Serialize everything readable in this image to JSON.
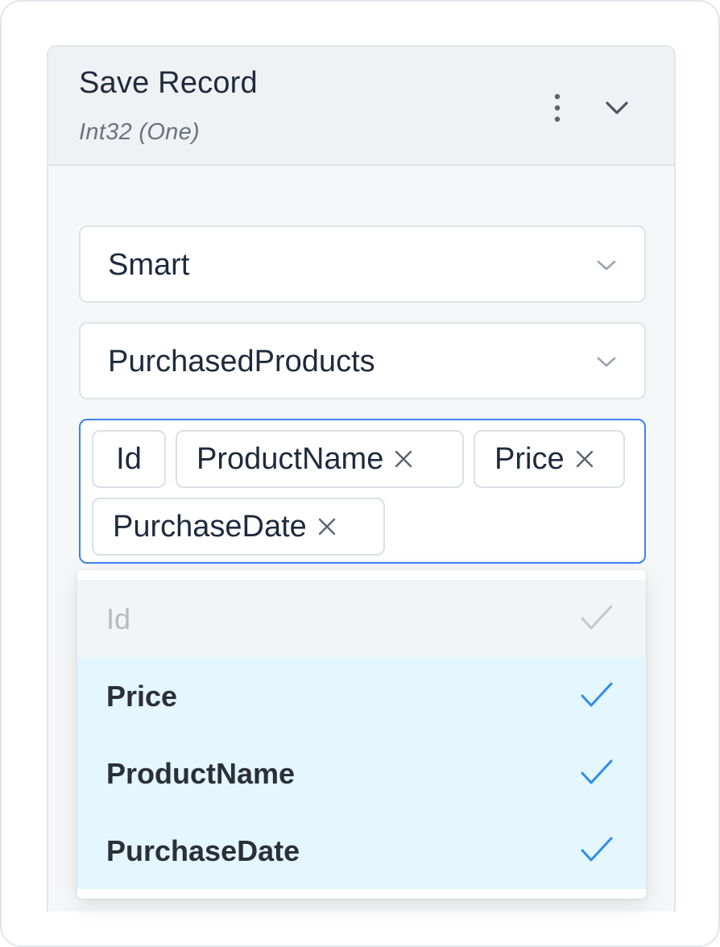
{
  "node": {
    "title": "Save Record",
    "subtitle": "Int32 (One)",
    "icons": {
      "more": "more-vertical-icon",
      "collapse": "chevron-down-icon"
    }
  },
  "mode_select": {
    "value": "Smart",
    "icon": "chevron-down-icon"
  },
  "table_select": {
    "value": "PurchasedProducts",
    "icon": "chevron-down-icon"
  },
  "fields": {
    "tags": [
      {
        "label": "Id",
        "removable": false
      },
      {
        "label": "ProductName",
        "removable": true
      },
      {
        "label": "Price",
        "removable": true
      },
      {
        "label": "PurchaseDate",
        "removable": true
      }
    ],
    "remove_icon": "close-icon"
  },
  "dropdown": {
    "options": [
      {
        "label": "Id",
        "state": "disabled-checked"
      },
      {
        "label": "Price",
        "state": "selected"
      },
      {
        "label": "ProductName",
        "state": "selected"
      },
      {
        "label": "PurchaseDate",
        "state": "selected"
      }
    ],
    "check_icon": "check-icon"
  },
  "colors": {
    "accent_border": "#3b82f6",
    "check_active": "#2f8cf0",
    "check_disabled": "#c4c7cc",
    "selected_bg": "#e4f6fe",
    "disabled_bg": "#f3f4f6"
  }
}
